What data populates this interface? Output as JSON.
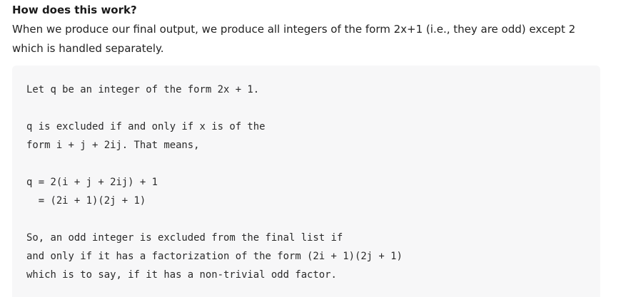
{
  "heading": "How does this work?",
  "paragraph": "When we produce our final output, we produce all integers of the form 2x+1 (i.e., they are odd) except 2 which is handled separately.",
  "code_lines": [
    "Let q be an integer of the form 2x + 1.",
    "",
    "q is excluded if and only if x is of the",
    "form i + j + 2ij. That means,",
    "",
    "q = 2(i + j + 2ij) + 1",
    "  = (2i + 1)(2j + 1)",
    "",
    "So, an odd integer is excluded from the final list if",
    "and only if it has a factorization of the form (2i + 1)(2j + 1)",
    "which is to say, if it has a non-trivial odd factor."
  ]
}
